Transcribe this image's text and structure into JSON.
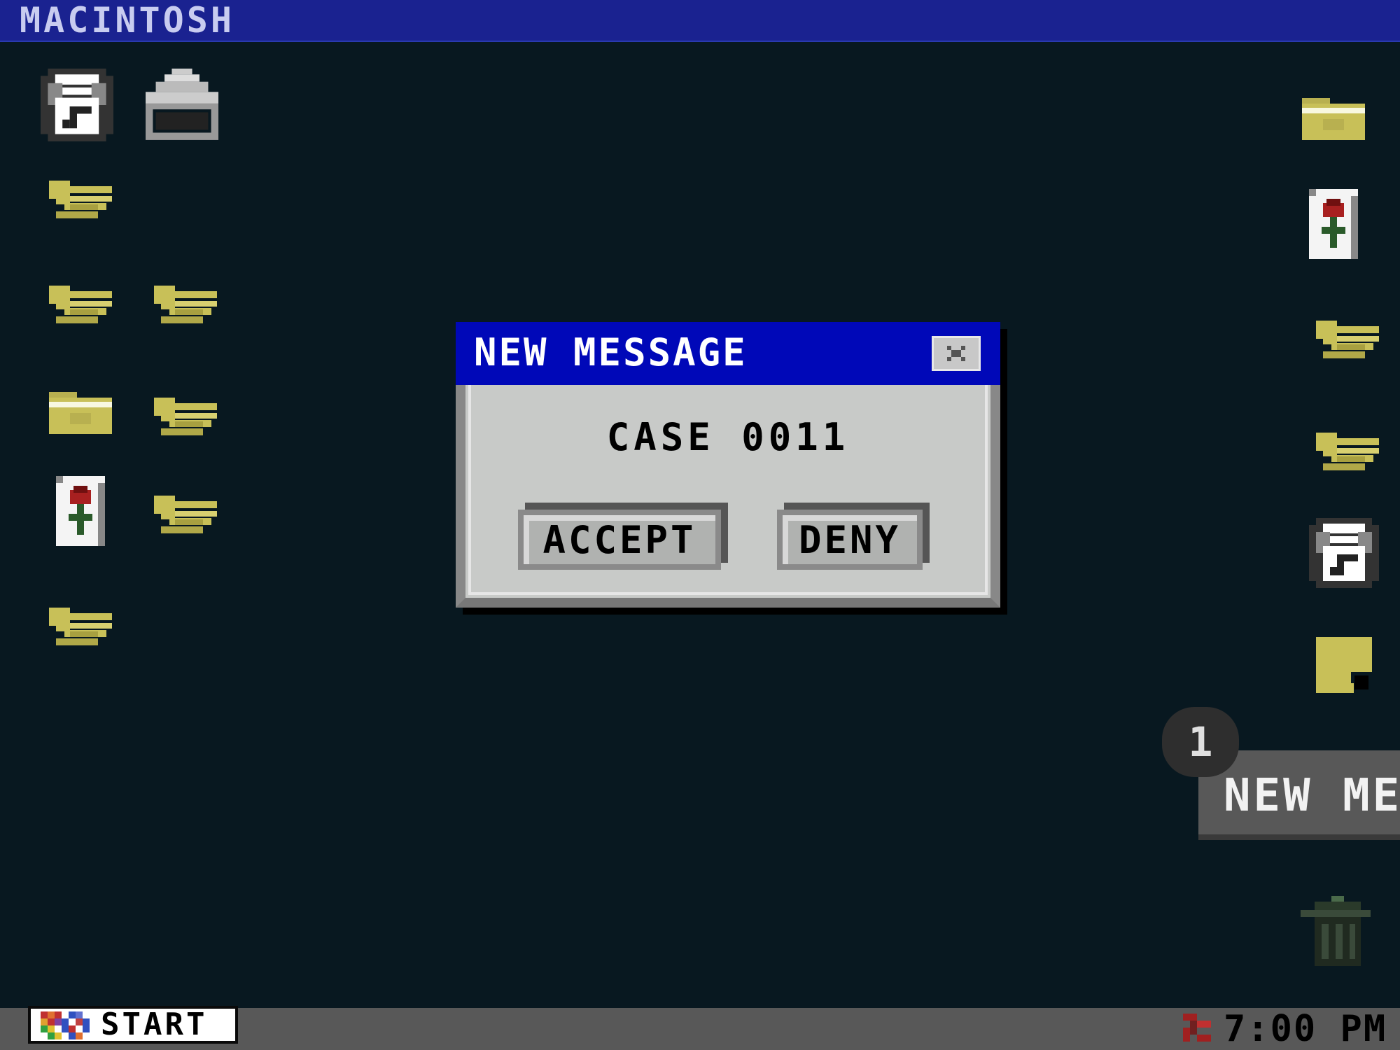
{
  "menubar": {
    "title": "MACINTOSH"
  },
  "desktop": {
    "left_icons": [
      "disk-icon",
      "printer-icon",
      "folder-open-icon",
      "folder-open-icon",
      "folder-open-icon",
      "folder-closed-icon",
      "folder-open-icon",
      "rose-card-icon",
      "folder-open-icon",
      "folder-open-icon"
    ],
    "right_icons": [
      "folder-closed-icon",
      "rose-card-icon",
      "folder-open-icon",
      "folder-open-icon",
      "disk-icon",
      "note-icon",
      "trash-icon"
    ]
  },
  "dialog": {
    "title": "NEW MESSAGE",
    "message": "CASE 0011",
    "accept_label": "ACCEPT",
    "deny_label": "DENY",
    "close_icon": "close-icon"
  },
  "notification": {
    "count": "1",
    "text": "NEW ME"
  },
  "taskbar": {
    "start_label": "START",
    "clock": "7:00 PM"
  },
  "colors": {
    "desktop": "#081820",
    "menubar": "#1a2290",
    "dialog_titlebar": "#0008b8",
    "folder": "#c8c058",
    "taskbar": "#585858"
  }
}
